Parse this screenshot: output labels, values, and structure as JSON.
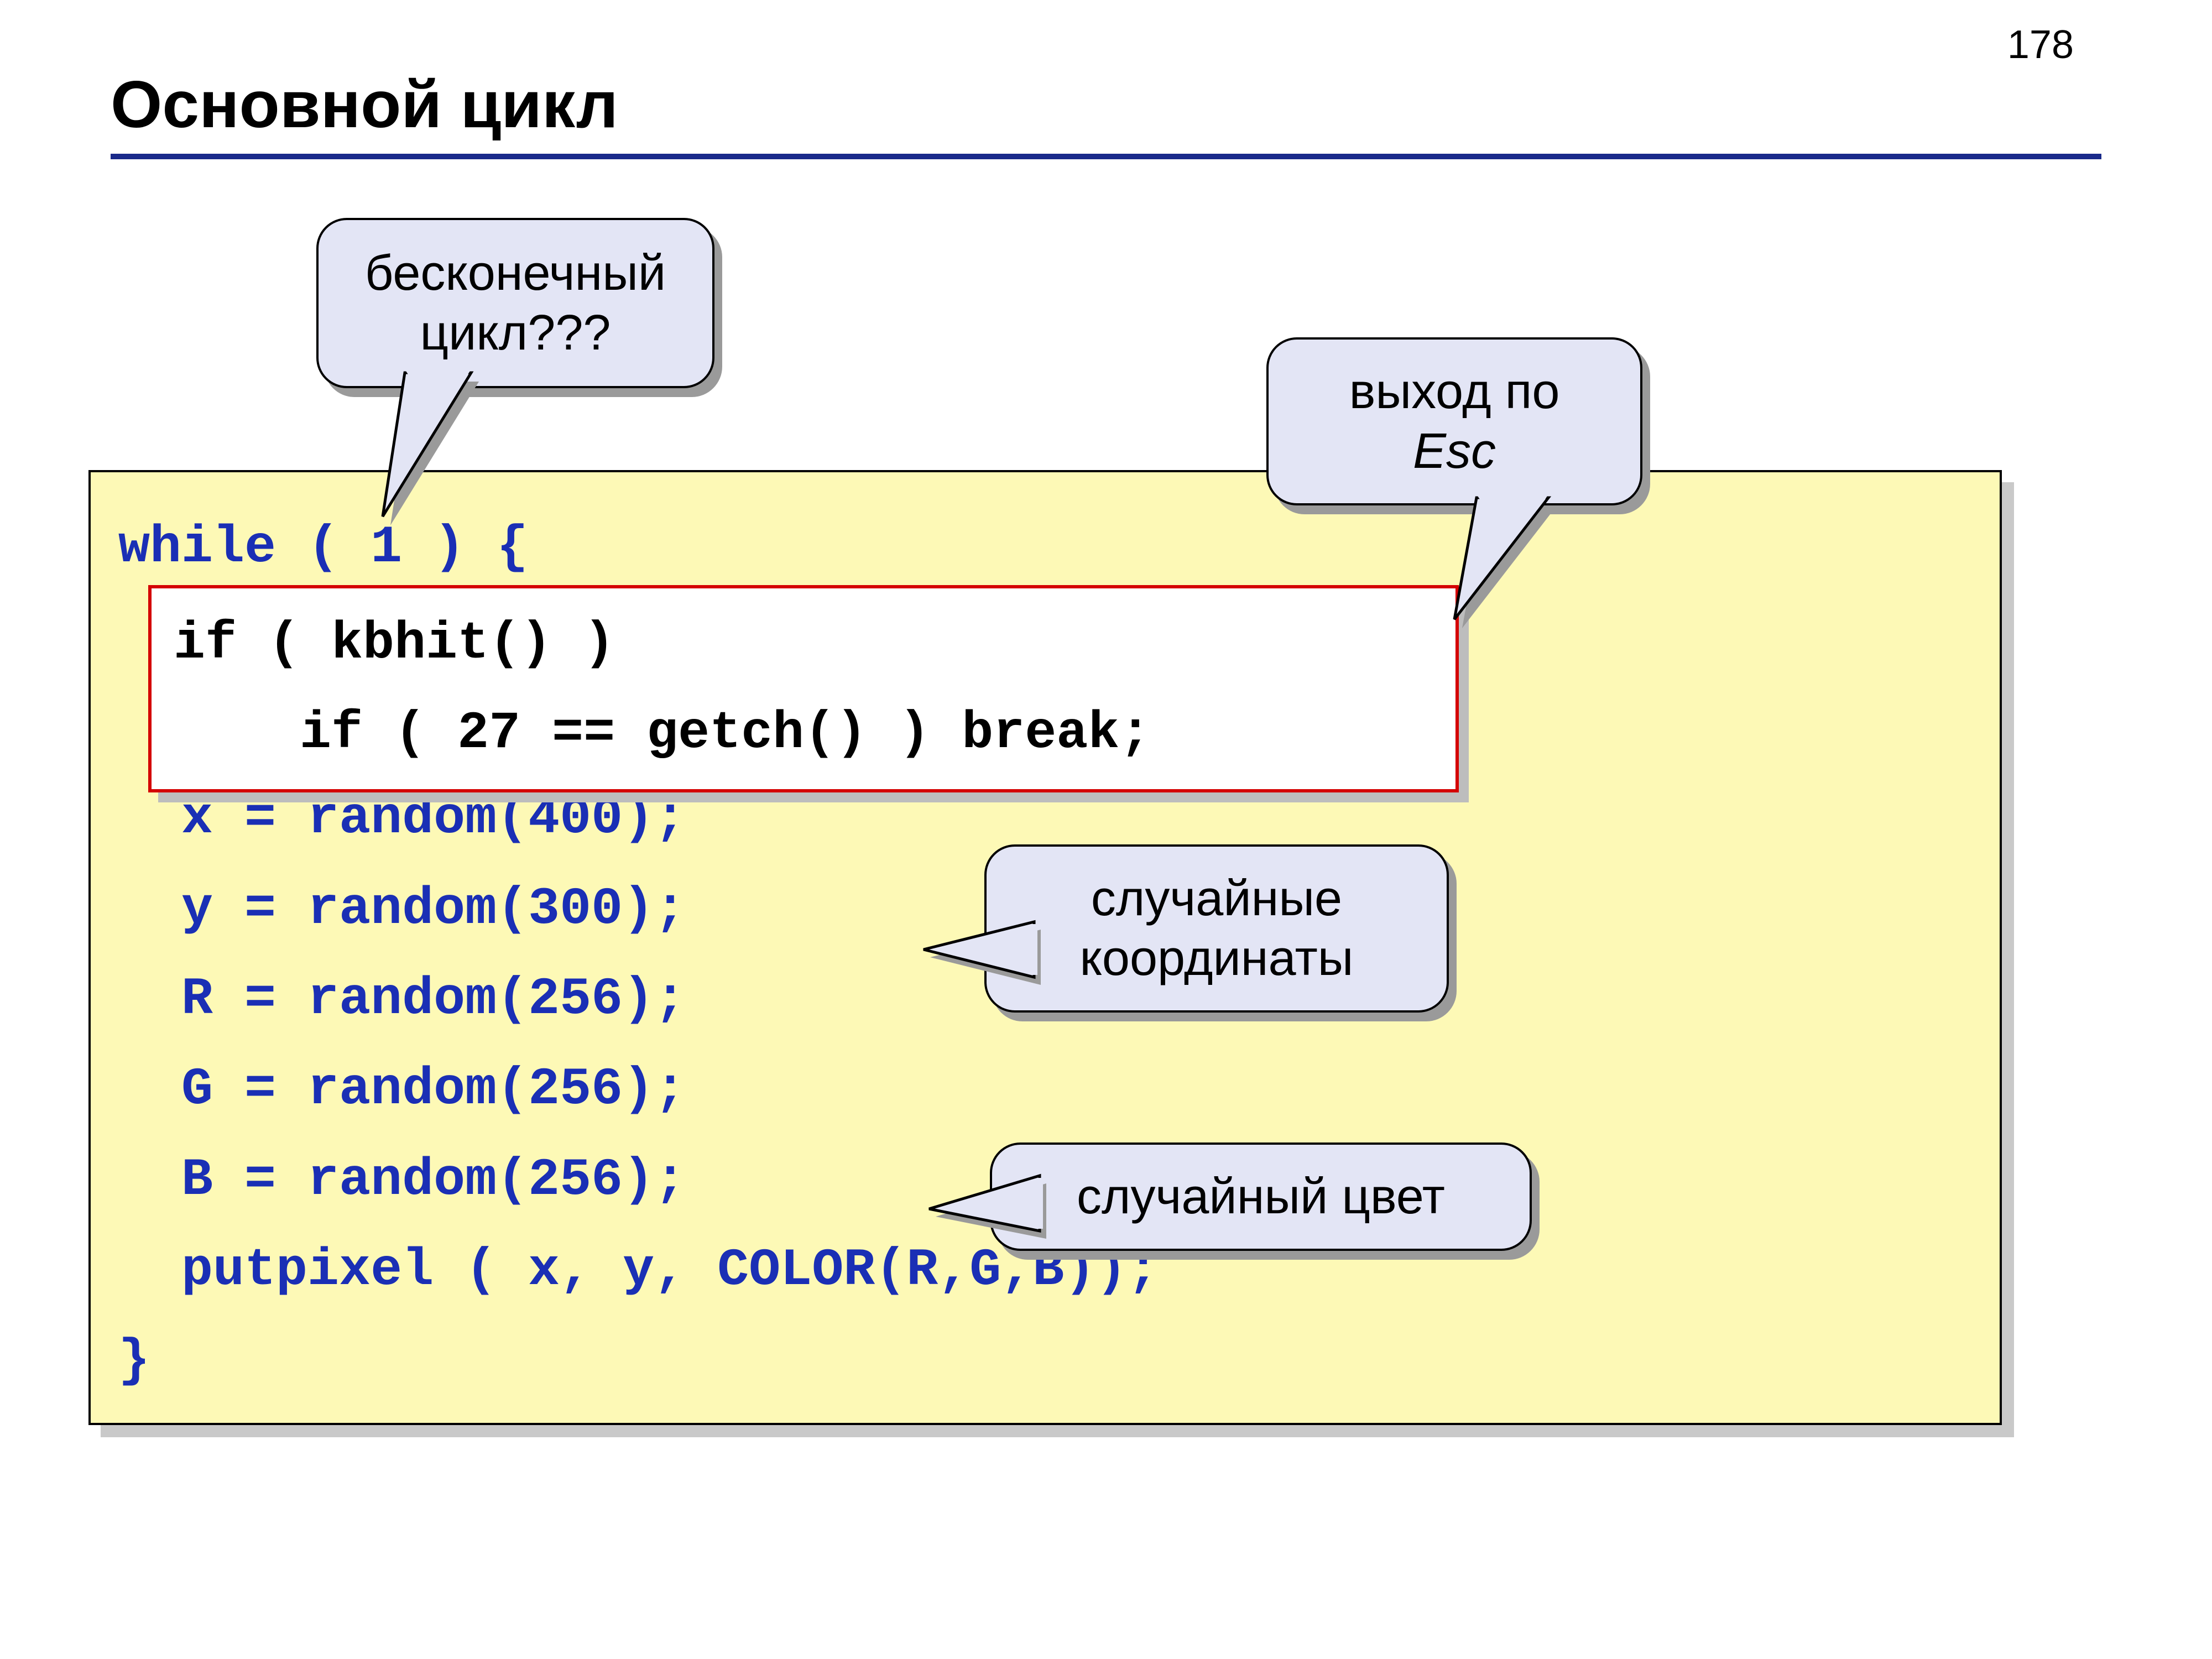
{
  "page_number": "178",
  "title": "Основной цикл",
  "code": {
    "line1": "while ( 1 ) {",
    "inner": "if ( kbhit() )\n    if ( 27 == getch() ) break;",
    "afterInner": "  x = random(400);\n  y = random(300);\n  R = random(256);\n  G = random(256);\n  B = random(256);\n  putpixel ( x, y, COLOR(R,G,B));\n}"
  },
  "callouts": {
    "infinite_loop": "бесконечный\nцикл???",
    "exit_esc_line1": "выход по",
    "exit_esc_line2": "Esc",
    "random_coords": "случайные\nкоординаты",
    "random_color": "случайный цвет"
  }
}
